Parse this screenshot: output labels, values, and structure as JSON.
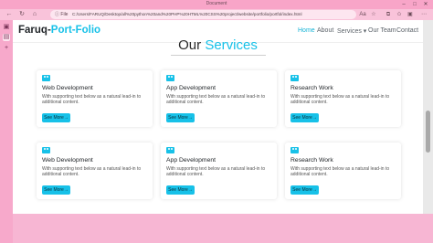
{
  "window": {
    "title": "Document"
  },
  "browser": {
    "url_prefix": "File",
    "url": "C:/Users/FARUQ/Desktop/all%20python%20and%20PHP%20HTML%20CSS%20project/website/portfolio/portfol/index.html"
  },
  "navbar": {
    "brand_main": "Faruq-",
    "brand_accent": "Port-Folio",
    "links": [
      "Home",
      "About",
      "Services",
      "Our Team",
      "Contact"
    ]
  },
  "section": {
    "heading_main": "Our",
    "heading_accent": "Services"
  },
  "cards": [
    {
      "title": "Web Development",
      "text": "With supporting text below as a natural lead-in to additional content.",
      "button": "See More→"
    },
    {
      "title": "App Development",
      "text": "With supporting text below as a natural lead-in to additional content.",
      "button": "See More→"
    },
    {
      "title": "Research Work",
      "text": "With supporting text below as a natural lead-in to additional content.",
      "button": "See More→"
    },
    {
      "title": "Web Development",
      "text": "With supporting text below as a natural lead-in to additional content.",
      "button": "See More→"
    },
    {
      "title": "App Development",
      "text": "With supporting text below as a natural lead-in to additional content.",
      "button": "See More→"
    },
    {
      "title": "Research Work",
      "text": "With supporting text below as a natural lead-in to additional content.",
      "button": "See More→"
    }
  ],
  "colors": {
    "accent": "#17c1e8",
    "browser_chrome": "#f8a5c8"
  }
}
